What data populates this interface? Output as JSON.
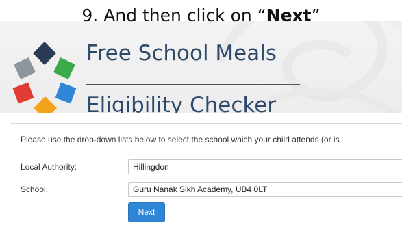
{
  "caption": {
    "number": "9.",
    "text_before": "And then click on “",
    "emphasis": "Next",
    "text_after": "”"
  },
  "header": {
    "title_line1": "Free School Meals",
    "title_line2": "Eligibility Checker"
  },
  "form": {
    "intro": "Please use the drop-down lists below to select the school which your child attends (or is",
    "local_authority_label": "Local Authority:",
    "local_authority_value": "Hillingdon",
    "school_label": "School:",
    "school_value": "Guru Nanak Sikh Academy, UB4 0LT",
    "next_label": "Next"
  },
  "colors": {
    "title": "#2e4a6b",
    "button": "#2f86d6",
    "logo_top": "#2b3b55",
    "logo_green": "#3aaa4a",
    "logo_blue": "#2f86d6",
    "logo_orange": "#f2a21b",
    "logo_red": "#e23b33",
    "logo_gray": "#8c969d"
  }
}
